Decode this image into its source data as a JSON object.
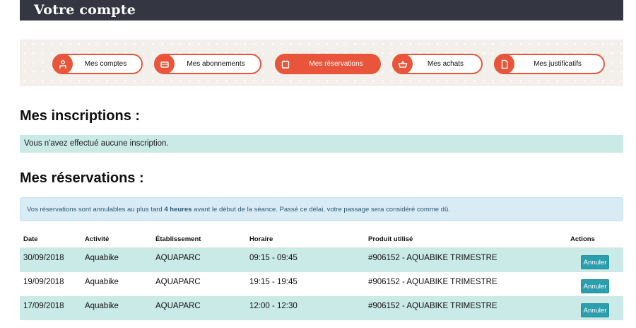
{
  "header": {
    "title": "Votre compte"
  },
  "nav": {
    "items": [
      {
        "label": "Mes comptes",
        "icon": "person-icon"
      },
      {
        "label": "Mes abonnements",
        "icon": "card-icon"
      },
      {
        "label": "Mes réservations",
        "icon": "calendar-icon",
        "active": true
      },
      {
        "label": "Mes achats",
        "icon": "basket-icon"
      },
      {
        "label": "Mes justificatifs",
        "icon": "document-icon"
      }
    ]
  },
  "inscriptions": {
    "title": "Mes inscriptions :",
    "empty_message": "Vous n'avez effectué aucune inscription."
  },
  "reservations": {
    "title": "Mes réservations :",
    "notice_before": "Vos réservations sont annulables au plus tard ",
    "notice_bold": "4 heures",
    "notice_after": " avant le début de la séance. Passé ce délai, votre passage sera considéré comme dû.",
    "columns": [
      "Date",
      "Activité",
      "Établissement",
      "Horaire",
      "Produit utilisé",
      "Actions"
    ],
    "rows": [
      {
        "date": "30/09/2018",
        "activity": "Aquabike",
        "venue": "AQUAPARC",
        "time": "09:15 - 09:45",
        "product": "#906152 - AQUABIKE TRIMESTRE",
        "action": "Annuler"
      },
      {
        "date": "19/09/2018",
        "activity": "Aquabike",
        "venue": "AQUAPARC",
        "time": "19:15 - 19:45",
        "product": "#906152 - AQUABIKE TRIMESTRE",
        "action": "Annuler"
      },
      {
        "date": "17/09/2018",
        "activity": "Aquabike",
        "venue": "AQUAPARC",
        "time": "12:00 - 12:30",
        "product": "#906152 - AQUABIKE TRIMESTRE",
        "action": "Annuler"
      }
    ]
  },
  "colors": {
    "header_bg": "#343741",
    "accent": "#e8553a",
    "teal_row": "#c9eae7",
    "info_blue": "#d8ecf6",
    "button": "#2b9fae"
  }
}
